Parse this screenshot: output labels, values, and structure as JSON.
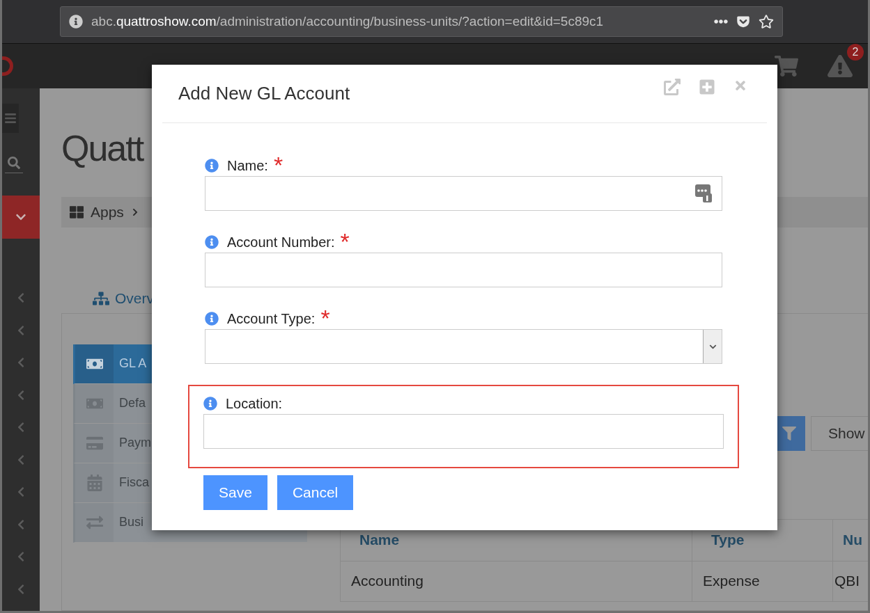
{
  "browser": {
    "url_prefix": "abc.",
    "url_domain": "quattroshow.com",
    "url_path": "/administration/accounting/business-units/?action=edit&id=5c89c1"
  },
  "topbar": {
    "alert_count": "2"
  },
  "sidebar": {
    "groups": [
      {
        "expanded": true
      },
      {
        "expanded": false
      },
      {
        "expanded": false
      },
      {
        "expanded": false
      },
      {
        "expanded": false
      },
      {
        "expanded": false
      },
      {
        "expanded": false
      },
      {
        "expanded": false
      },
      {
        "expanded": false
      },
      {
        "expanded": false
      },
      {
        "expanded": false
      }
    ]
  },
  "page": {
    "title": "Quatt",
    "breadcrumb": [
      "Apps"
    ],
    "tabs": [
      {
        "label": "Overv"
      }
    ],
    "side_menu": [
      {
        "label": "GL A",
        "kind": "money",
        "selected": true
      },
      {
        "label": "Defa",
        "kind": "money",
        "selected": false
      },
      {
        "label": "Paym",
        "kind": "card",
        "selected": false
      },
      {
        "label": "Fisca",
        "kind": "calendar",
        "selected": false
      },
      {
        "label": "Busi",
        "kind": "exchange",
        "selected": false
      }
    ],
    "toolbar": {
      "show_button": "Show"
    },
    "table": {
      "columns": [
        "Name",
        "Type",
        "Nu"
      ],
      "rows": [
        [
          "Accounting",
          "Expense",
          "QBI"
        ]
      ]
    }
  },
  "modal": {
    "title": "Add New GL Account",
    "fields": [
      {
        "label": "Name:",
        "marker": "*",
        "kind": "text",
        "badge_icon": true,
        "highlighted": false
      },
      {
        "label": "Account Number:",
        "marker": "*",
        "kind": "text",
        "badge_icon": false,
        "highlighted": false
      },
      {
        "label": "Account Type:",
        "marker": "*",
        "kind": "select",
        "badge_icon": false,
        "highlighted": false
      },
      {
        "label": "Location:",
        "kind": "text",
        "badge_icon": false,
        "highlighted": true
      }
    ],
    "buttons": [
      {
        "label": "Save"
      },
      {
        "label": "Cancel"
      }
    ]
  }
}
